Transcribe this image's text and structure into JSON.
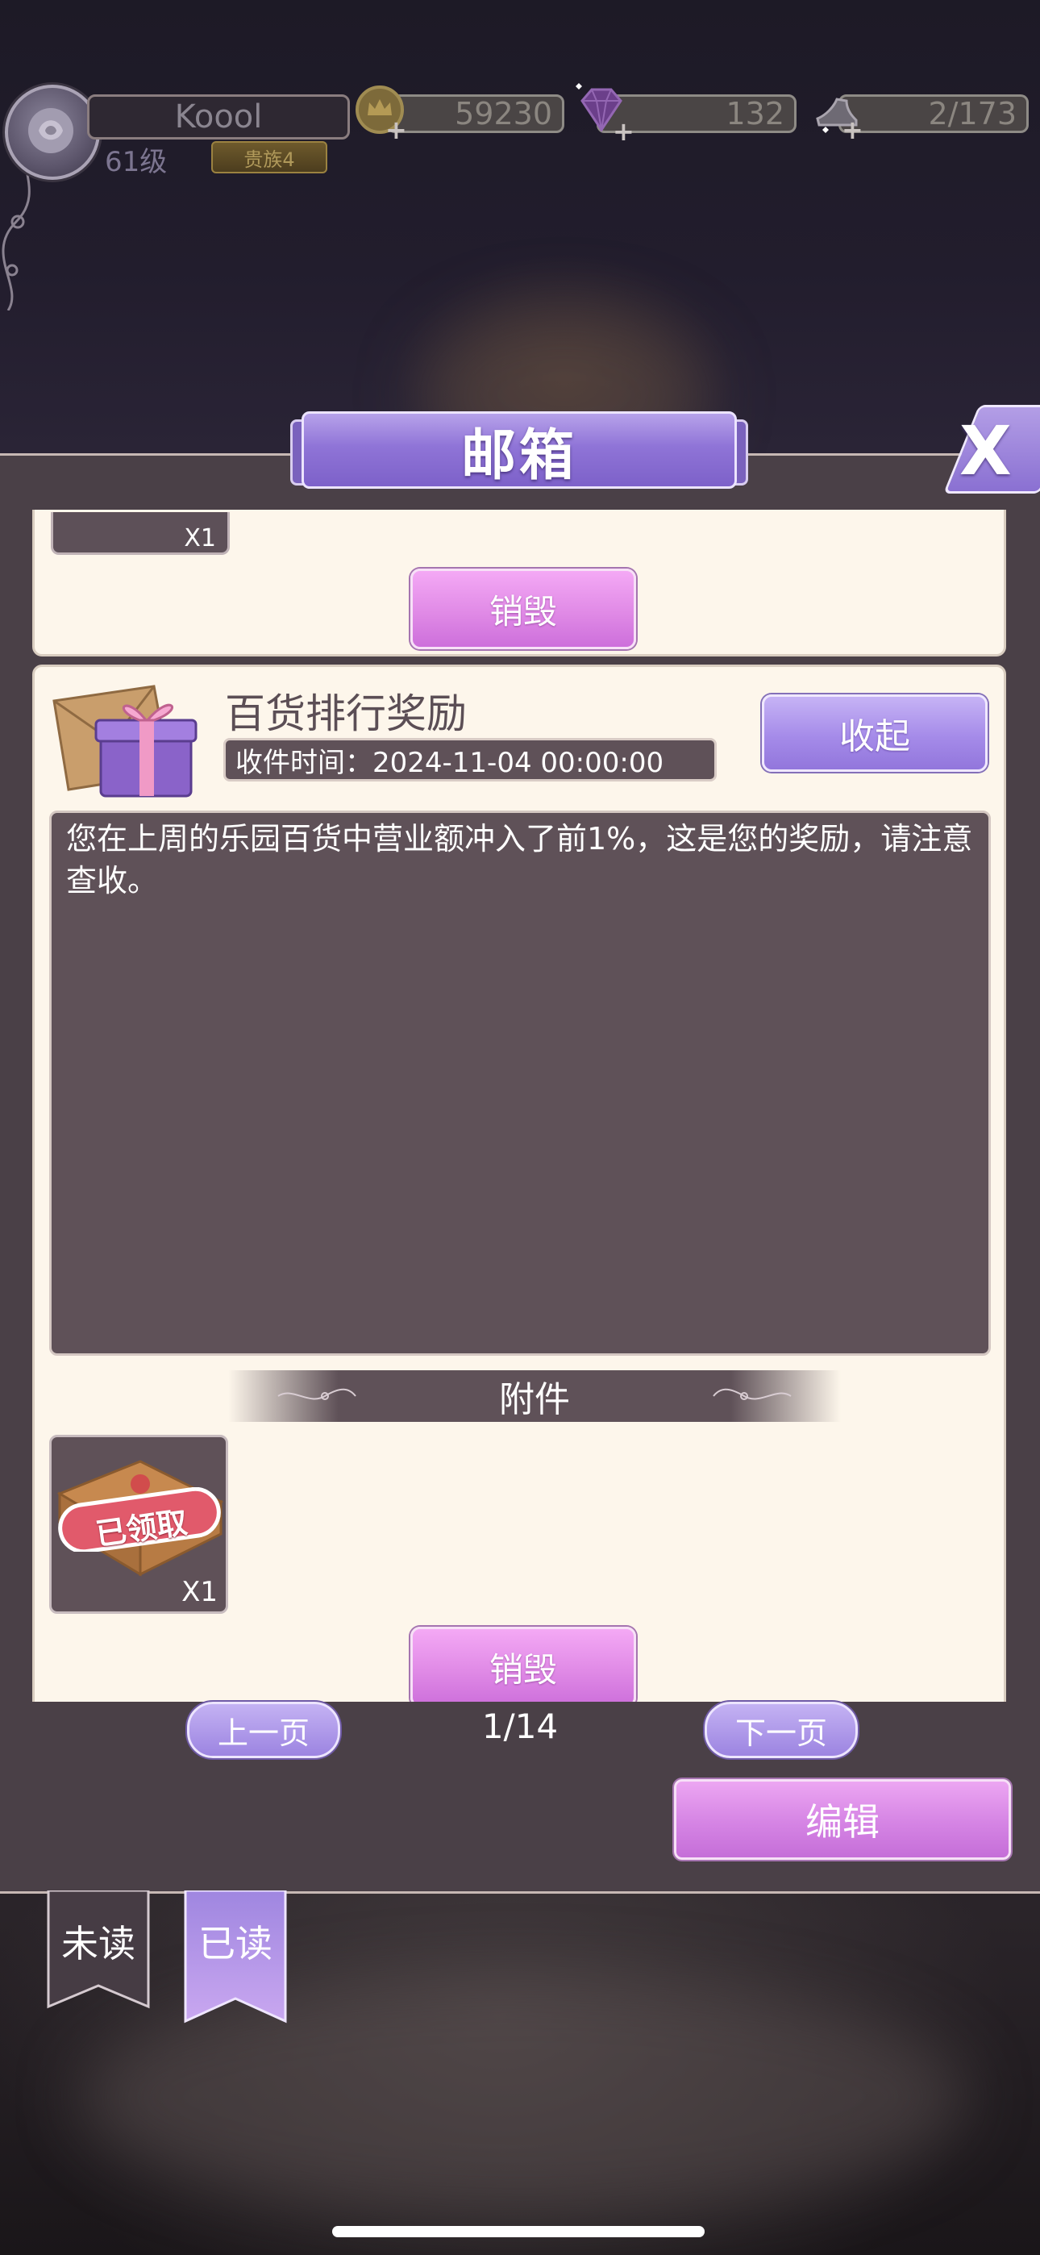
{
  "hud": {
    "player_name": "Koool",
    "level": "61级",
    "vip": "贵族4",
    "gold": "59230",
    "diamonds": "132",
    "stamina": "2/173"
  },
  "mailbox": {
    "title": "邮箱",
    "close_label": "X",
    "previous_mail": {
      "item_qty": "X1",
      "destroy_label": "销毁"
    },
    "mail": {
      "title": "百货排行奖励",
      "received_time": "收件时间：2024-11-04 00:00:00",
      "collapse_label": "收起",
      "body": "您在上周的乐园百货中营业额冲入了前1%，这是您的奖励，请注意查收。",
      "attachments_label": "附件",
      "attachment": {
        "stamp": "已领取",
        "qty": "X1"
      },
      "destroy_label": "销毁"
    },
    "pagination": {
      "prev_label": "上一页",
      "page": "1/14",
      "next_label": "下一页"
    },
    "edit_label": "编辑"
  },
  "tabs": [
    {
      "label": "未读",
      "active": false
    },
    {
      "label": "已读",
      "active": true
    }
  ],
  "colors": {
    "accent_purple": "#9c84e1",
    "accent_pink": "#e08ae6",
    "card_bg": "#fdf6eb",
    "panel_bg": "#4a4047"
  }
}
